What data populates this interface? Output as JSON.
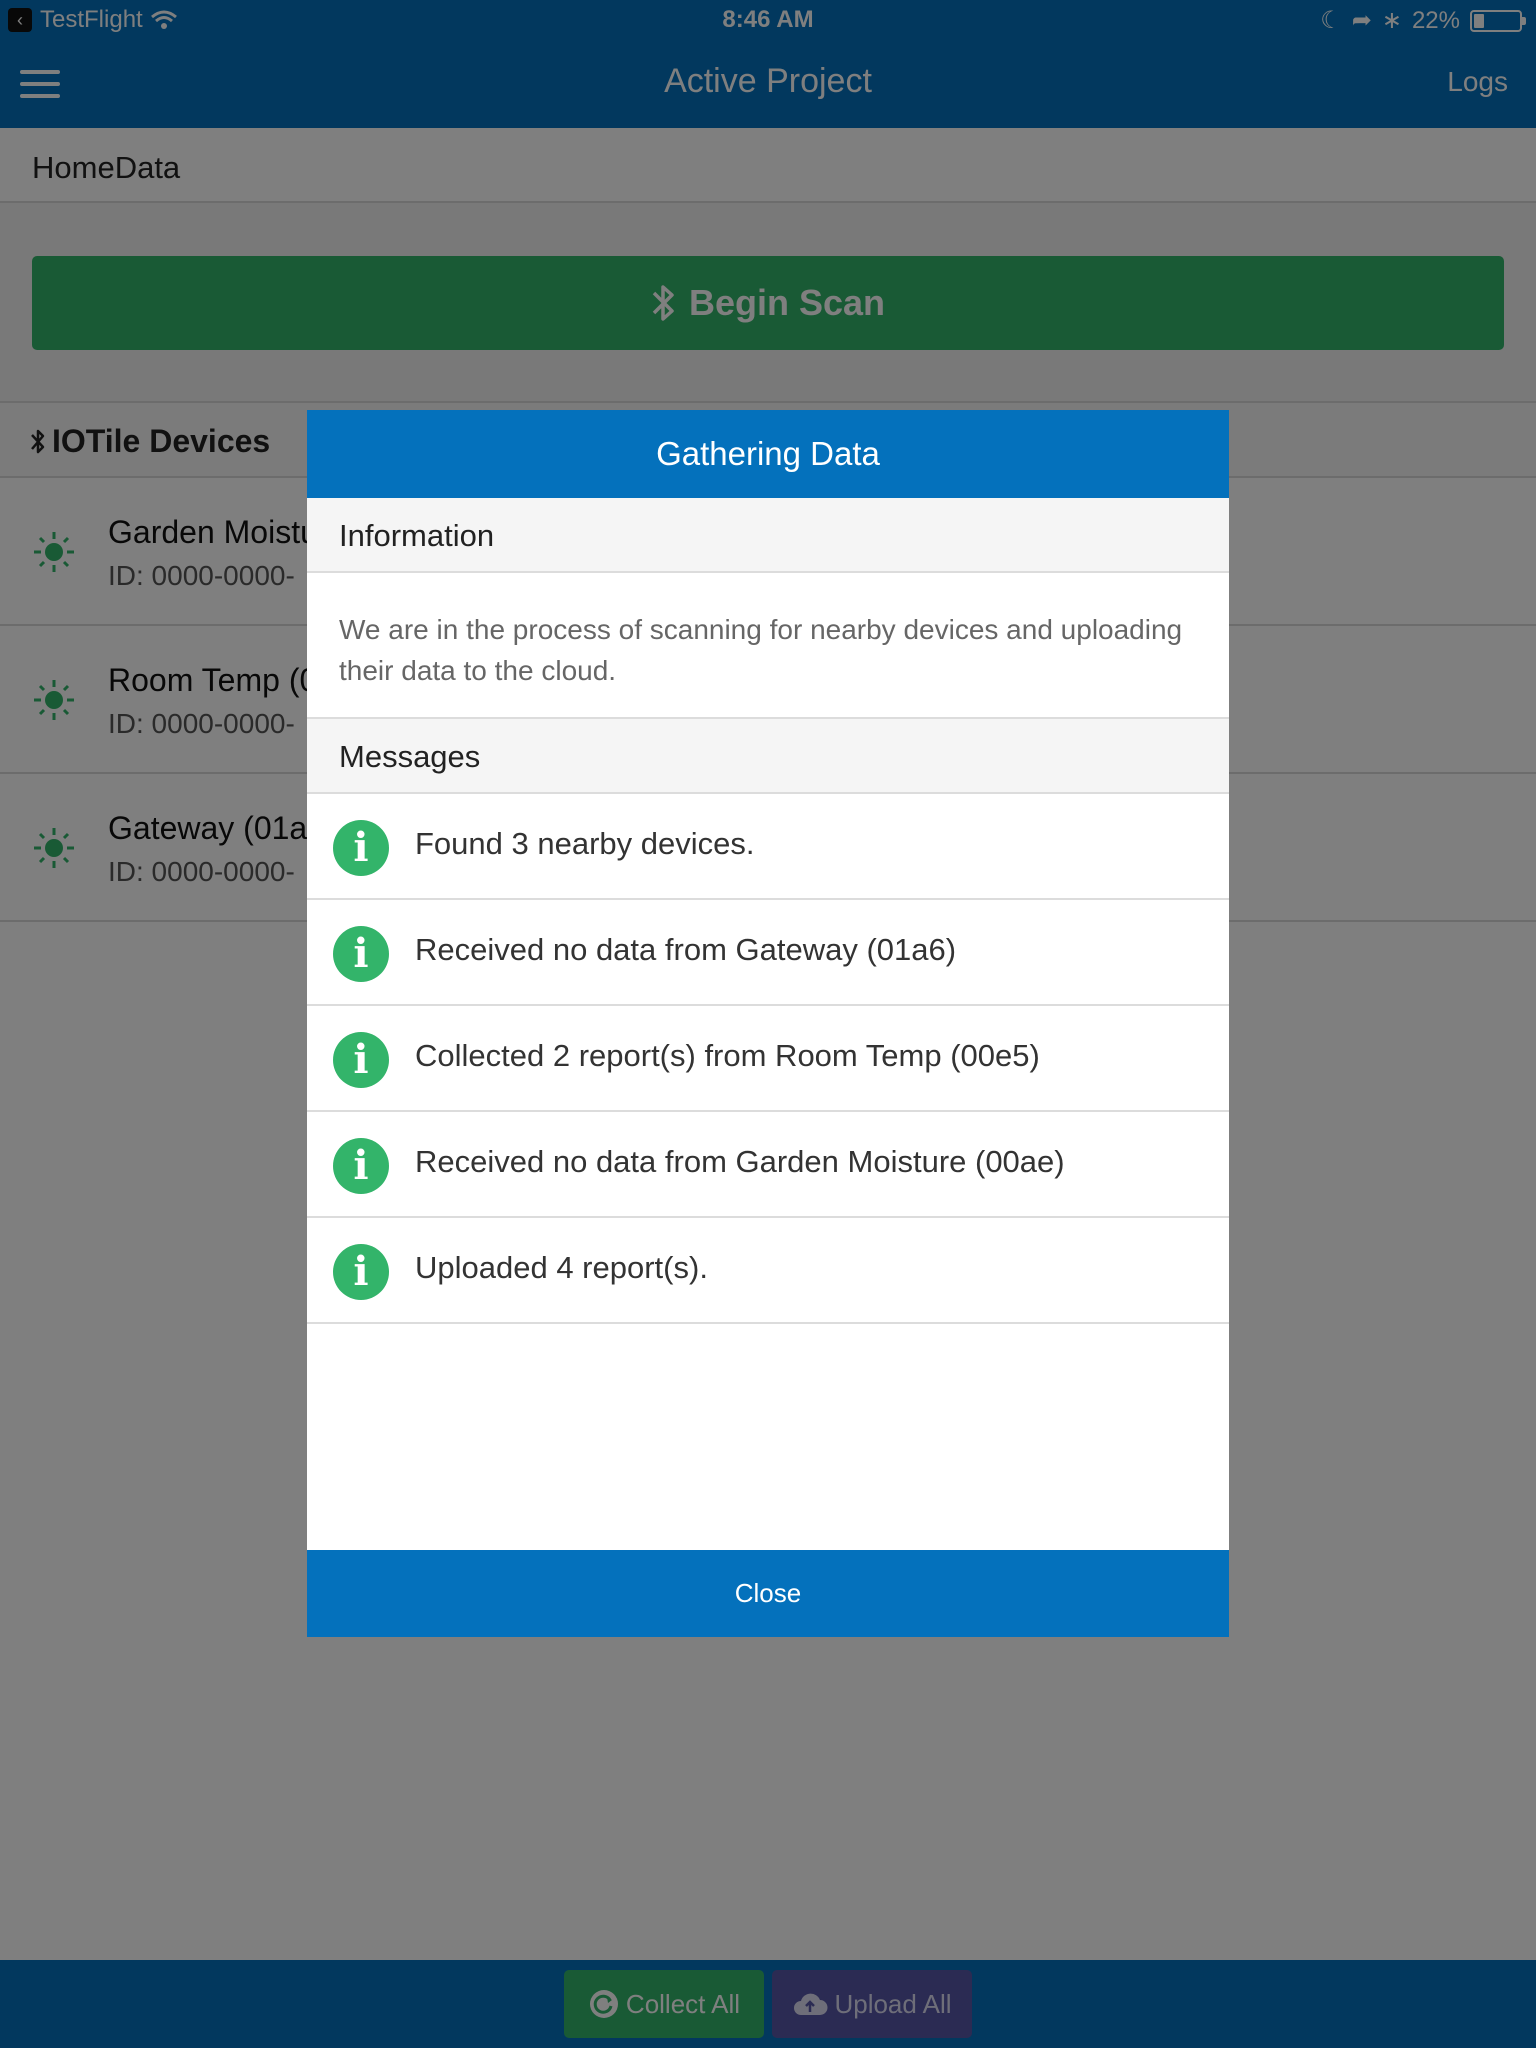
{
  "status_bar": {
    "back_app": "TestFlight",
    "time": "8:46 AM",
    "battery": "22%",
    "battery_level": 0.22
  },
  "nav": {
    "title": "Active Project",
    "logs": "Logs"
  },
  "project": {
    "name": "HomeData"
  },
  "scan": {
    "label": "Begin Scan"
  },
  "devices": {
    "header": "IOTile Devices",
    "items": [
      {
        "name": "Garden Moistu",
        "id": "ID: 0000-0000-"
      },
      {
        "name": "Room Temp (0",
        "id": "ID: 0000-0000-"
      },
      {
        "name": "Gateway (01a",
        "id": "ID: 0000-0000-"
      }
    ]
  },
  "bottom": {
    "collect": "Collect All",
    "upload": "Upload All"
  },
  "modal": {
    "title": "Gathering Data",
    "info_title": "Information",
    "info_text": "We are in the process of scanning for nearby devices and uploading their data to the cloud.",
    "messages_title": "Messages",
    "messages": [
      "Found 3 nearby devices.",
      "Received no data from Gateway (01a6)",
      "Collected 2 report(s) from Room Temp (00e5)",
      "Received no data from Garden Moisture (00ae)",
      "Uploaded 4 report(s)."
    ],
    "icon_glyph": "i",
    "close": "Close"
  },
  "colors": {
    "brand_blue": "#0471bc",
    "success_green": "#33b46a",
    "upload_purple": "#5757a6"
  }
}
